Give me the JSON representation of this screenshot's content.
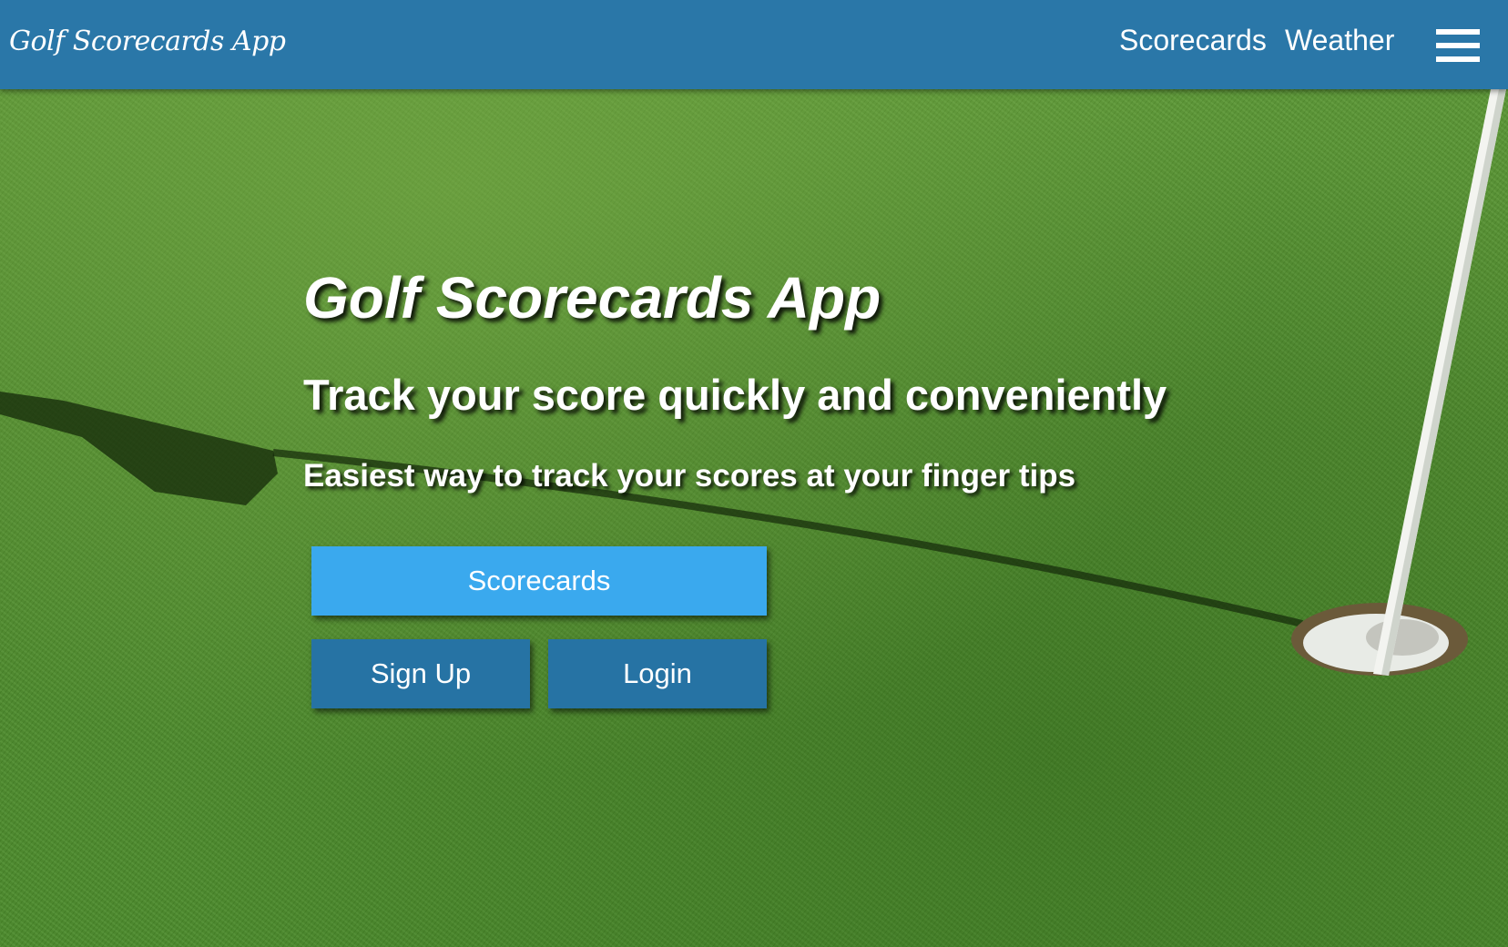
{
  "navbar": {
    "brand": "Golf Scorecards App",
    "links": [
      {
        "label": "Scorecards"
      },
      {
        "label": "Weather"
      }
    ],
    "menu_icon": "hamburger-menu-icon"
  },
  "hero": {
    "title": "Golf Scorecards App",
    "subtitle": "Track your score quickly and conveniently",
    "tagline": "Easiest way to track your scores at your finger tips",
    "buttons": {
      "scorecards": "Scorecards",
      "signup": "Sign Up",
      "login": "Login"
    },
    "background_image": "golf-green-with-flagstick-and-hole"
  },
  "colors": {
    "navbar": "#2a77a8",
    "primary_button": "#3aa9ee",
    "secondary_button": "#2673a4",
    "text": "#ffffff"
  }
}
